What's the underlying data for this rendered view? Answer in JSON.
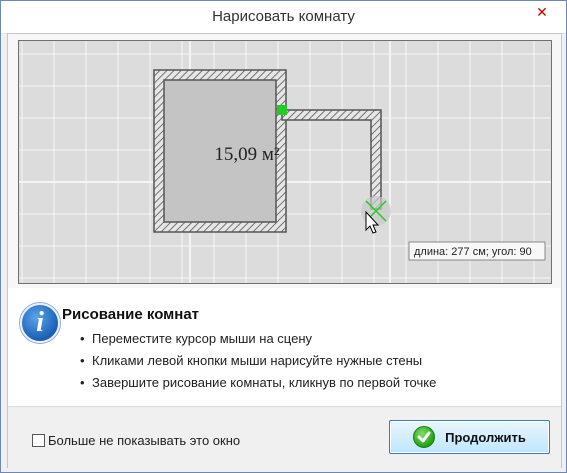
{
  "window": {
    "title": "Нарисовать комнату",
    "close_glyph": "✕"
  },
  "canvas": {
    "room_area": "15,09 м²",
    "tooltip": "длина: 277 см; угол: 90"
  },
  "info": {
    "icon_glyph": "i",
    "title": "Рисование комнат",
    "items": [
      "Переместите курсор мыши на сцену",
      "Кликами левой кнопки мыши нарисуйте нужные стены",
      "Завершите рисование комнаты, кликнув по первой точке"
    ]
  },
  "footer": {
    "dont_show_label": "Больше не показывать это окно",
    "continue_label": "Продолжить"
  },
  "colors": {
    "accent_green": "#22cc22",
    "accent_blue": "#3c7fb1"
  }
}
